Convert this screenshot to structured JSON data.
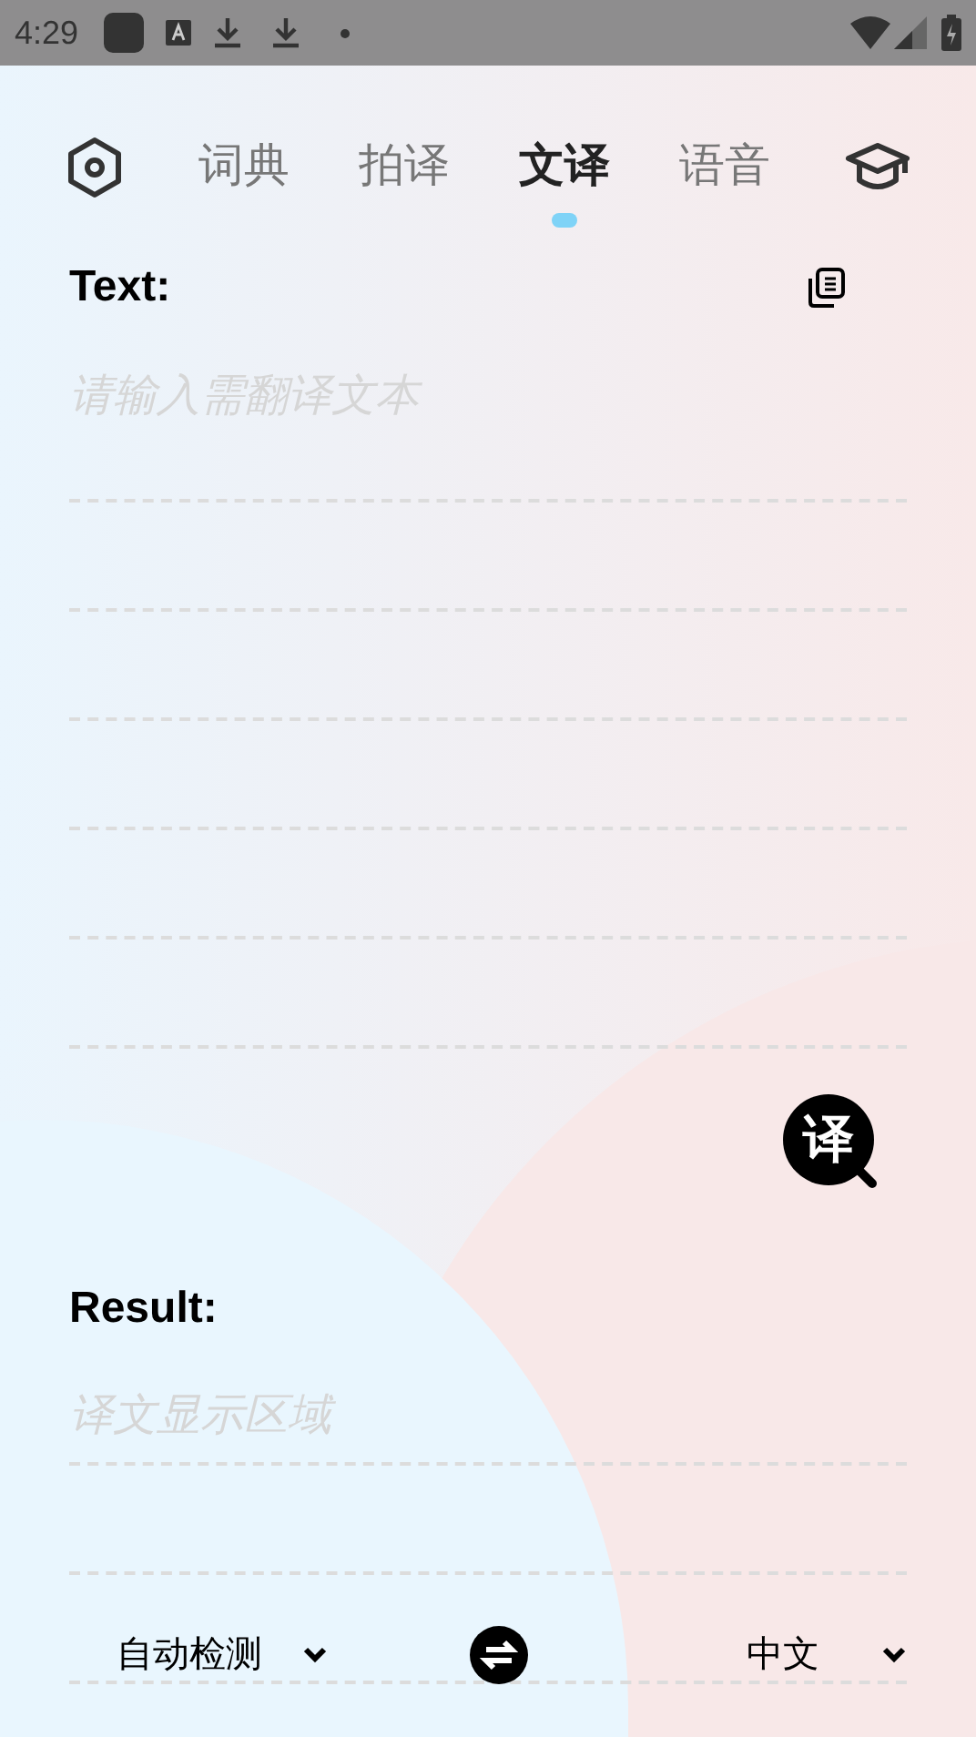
{
  "status_bar": {
    "time": "4:29"
  },
  "tabs": [
    {
      "label": "词典",
      "selected": false
    },
    {
      "label": "拍译",
      "selected": false
    },
    {
      "label": "文译",
      "selected": true
    },
    {
      "label": "语音",
      "selected": false
    }
  ],
  "input": {
    "label": "Text:",
    "placeholder": "请输入需翻译文本"
  },
  "translate_button": {
    "label": "译"
  },
  "result": {
    "label": "Result:",
    "placeholder": "译文显示区域"
  },
  "languages": {
    "source": "自动检测",
    "target": "中文"
  }
}
